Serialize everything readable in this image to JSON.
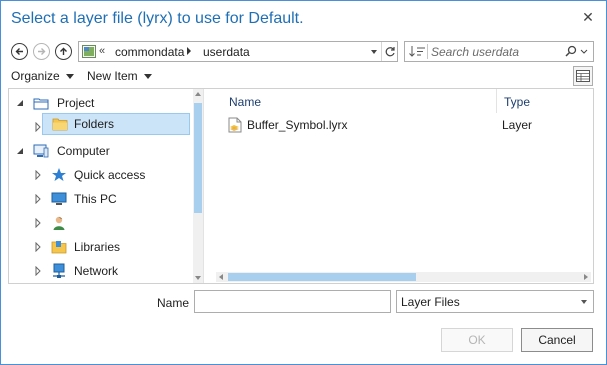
{
  "dialog": {
    "title": "Select a layer file (lyrx) to use for Default.",
    "close_glyph": "✕"
  },
  "navigation": {
    "back_icon": "back-arrow-icon",
    "forward_icon": "forward-arrow-icon",
    "up_icon": "up-arrow-icon",
    "path_overflow": "«",
    "breadcrumbs": [
      "commondata",
      "userdata"
    ],
    "search_placeholder": "Search userdata"
  },
  "toolbar": {
    "organize_label": "Organize",
    "new_item_label": "New Item"
  },
  "tree": {
    "items": [
      {
        "label": "Project",
        "icon": "project-icon"
      },
      {
        "label": "Folders",
        "icon": "folder-icon",
        "selected": true
      },
      {
        "label": "Computer",
        "icon": "computer-icon"
      },
      {
        "label": "Quick access",
        "icon": "star-icon"
      },
      {
        "label": "This PC",
        "icon": "monitor-icon"
      },
      {
        "label": "",
        "icon": "user-icon"
      },
      {
        "label": "Libraries",
        "icon": "libraries-icon"
      },
      {
        "label": "Network",
        "icon": "network-icon"
      }
    ]
  },
  "files": {
    "columns": {
      "name": "Name",
      "type": "Type"
    },
    "rows": [
      {
        "name": "Buffer_Symbol.lyrx",
        "type": "Layer"
      }
    ]
  },
  "footer": {
    "name_label": "Name",
    "name_value": "",
    "filter_value": "Layer Files",
    "ok_label": "OK",
    "cancel_label": "Cancel"
  },
  "colors": {
    "title_blue": "#1f6fb5",
    "selection_bg": "#cce4f7",
    "scroll_thumb": "#a8cfee"
  }
}
